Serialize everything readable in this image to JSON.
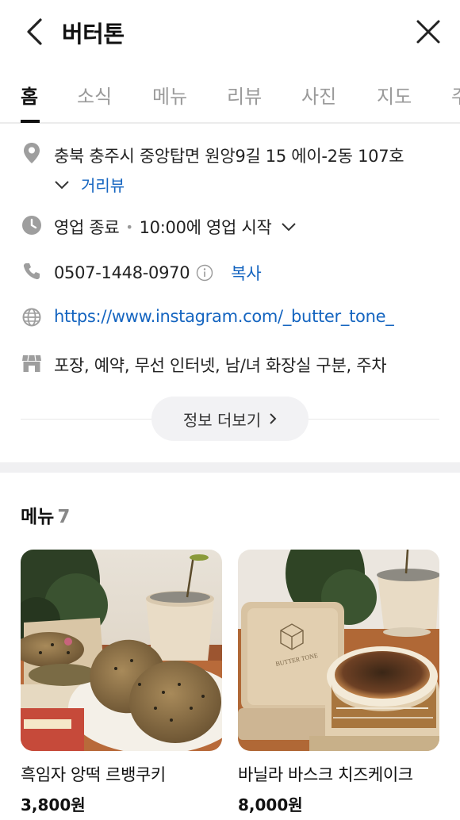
{
  "header": {
    "title": "버터톤",
    "back_icon": "chevron-left-icon",
    "close_icon": "close-icon"
  },
  "tabs": [
    {
      "label": "홈",
      "active": true
    },
    {
      "label": "소식"
    },
    {
      "label": "메뉴"
    },
    {
      "label": "리뷰"
    },
    {
      "label": "사진"
    },
    {
      "label": "지도"
    },
    {
      "label": "주"
    }
  ],
  "info": {
    "address": "충북 충주시 중앙탑면 원앙9길 15 에이-2동 107호",
    "street_view": "거리뷰",
    "hours_status": "영업 종료",
    "hours_next": "10:00에 영업 시작",
    "phone": "0507-1448-0970",
    "copy_label": "복사",
    "website": "https://www.instagram.com/_butter_tone_",
    "amenities": "포장, 예약, 무선 인터넷, 남/녀 화장실 구분, 주차",
    "more_label": "정보 더보기"
  },
  "menu": {
    "title": "메뉴",
    "count": "7",
    "items": [
      {
        "name": "흑임자 앙떡 르뱅쿠키",
        "price": "3,800원"
      },
      {
        "name": "바닐라 바스크 치즈케이크",
        "price": "8,000원"
      }
    ],
    "box_stamp": "BUTTER TONE"
  },
  "colors": {
    "link": "#1565c0",
    "icon_gray": "#9e9e9e",
    "section_gap": "#f0f0f2"
  }
}
